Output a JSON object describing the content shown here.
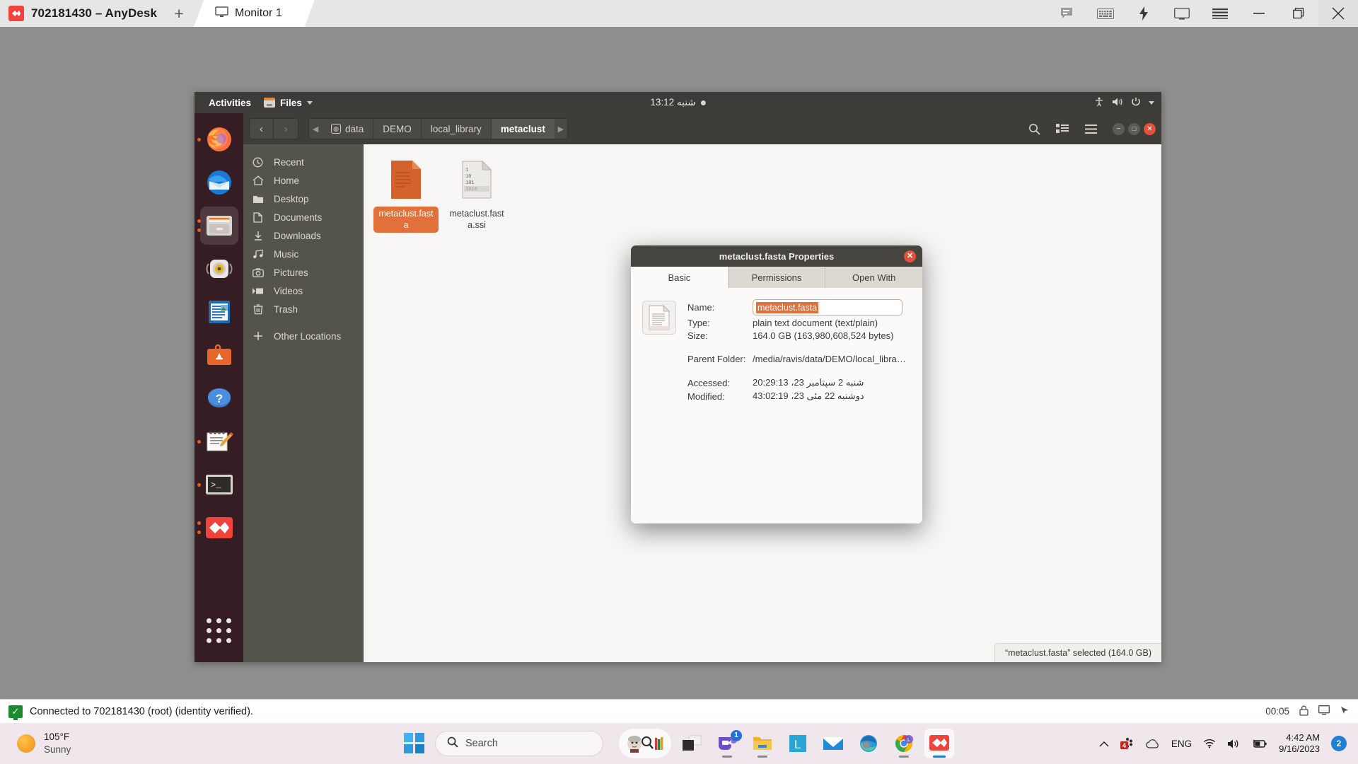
{
  "anydesk": {
    "brand_title": "702181430 – AnyDesk",
    "new_tab_label": "+",
    "tab_label": "Monitor 1",
    "tab_icon": "monitor-icon",
    "toolbar_icons": [
      "chat-icon",
      "keyboard-icon",
      "lightning-icon",
      "screen-icon",
      "hamburger-menu-icon"
    ],
    "window_controls": {
      "minimize": "—",
      "maximize": "❐",
      "close": "✕"
    },
    "status_text": "Connected to 702181430 (root) (identity verified).",
    "status_icon": "connected-check-icon",
    "session_time": "00:05",
    "status_right_icons": [
      "lock-icon",
      "monitor-icon",
      "arrow-icon"
    ]
  },
  "gnome": {
    "activities": "Activities",
    "app_menu": "Files",
    "app_menu_icon": "files-app-icon",
    "clock": "شنبه 13:12",
    "tray_icons": [
      "accessibility-icon",
      "volume-icon",
      "power-icon",
      "chevron-down-icon"
    ]
  },
  "dock": {
    "items": [
      {
        "name": "firefox-icon",
        "label": "Firefox",
        "running": true,
        "active": false
      },
      {
        "name": "thunderbird-icon",
        "label": "Thunderbird",
        "running": false,
        "active": false
      },
      {
        "name": "files-icon",
        "label": "Files",
        "running": true,
        "active": true
      },
      {
        "name": "rhythmbox-icon",
        "label": "Rhythmbox",
        "running": false,
        "active": false
      },
      {
        "name": "libreoffice-writer-icon",
        "label": "LibreOffice Writer",
        "running": false,
        "active": false
      },
      {
        "name": "ubuntu-software-icon",
        "label": "Ubuntu Software",
        "running": false,
        "active": false
      },
      {
        "name": "help-icon",
        "label": "Help",
        "running": false,
        "active": false
      },
      {
        "name": "text-editor-icon",
        "label": "Text Editor",
        "running": true,
        "active": false
      },
      {
        "name": "terminal-icon",
        "label": "Terminal",
        "running": true,
        "active": false
      },
      {
        "name": "anydesk-icon",
        "label": "AnyDesk",
        "running": true,
        "active": false
      }
    ],
    "show_apps_label": "Show Applications"
  },
  "nautilus": {
    "nav": {
      "back": "‹",
      "forward": "›"
    },
    "breadcrumbs": [
      {
        "label": "data",
        "icon": "device-icon",
        "current": false
      },
      {
        "label": "DEMO",
        "icon": "",
        "current": false
      },
      {
        "label": "local_library",
        "icon": "",
        "current": false
      },
      {
        "label": "metaclust",
        "icon": "",
        "current": true
      }
    ],
    "header_buttons": [
      "search-icon",
      "view-toggle-icon",
      "hamburger-menu-icon"
    ],
    "window_controls": [
      "minimize",
      "maximize",
      "close"
    ],
    "sidebar": [
      {
        "label": "Recent",
        "icon": "clock-icon"
      },
      {
        "label": "Home",
        "icon": "home-icon"
      },
      {
        "label": "Desktop",
        "icon": "folder-icon"
      },
      {
        "label": "Documents",
        "icon": "document-icon"
      },
      {
        "label": "Downloads",
        "icon": "download-icon"
      },
      {
        "label": "Music",
        "icon": "music-icon"
      },
      {
        "label": "Pictures",
        "icon": "camera-icon"
      },
      {
        "label": "Videos",
        "icon": "video-icon"
      },
      {
        "label": "Trash",
        "icon": "trash-icon"
      },
      {
        "label": "Other Locations",
        "icon": "plus-icon"
      }
    ],
    "files": [
      {
        "label": "metaclust.fasta",
        "icon": "text-file-icon",
        "selected": true
      },
      {
        "label": "metaclust.fasta.ssi",
        "icon": "binary-file-icon",
        "selected": false
      }
    ],
    "status_bar": "“metaclust.fasta” selected  (164.0 GB)"
  },
  "properties_dialog": {
    "title": "metaclust.fasta Properties",
    "close_label": "✕",
    "tabs": [
      {
        "label": "Basic",
        "active": true
      },
      {
        "label": "Permissions",
        "active": false
      },
      {
        "label": "Open With",
        "active": false
      }
    ],
    "thumb_icon": "text-document-icon",
    "fields": {
      "name_label": "Name:",
      "name_value": "metaclust.fasta",
      "type_label": "Type:",
      "type_value": "plain text document (text/plain)",
      "size_label": "Size:",
      "size_value": "164.0 GB (163,980,608,524 bytes)",
      "parent_label": "Parent Folder:",
      "parent_value": "/media/ravis/data/DEMO/local_libra…",
      "accessed_label": "Accessed:",
      "accessed_value": "شنبه  2 سپتامبر 23، 20:29:13",
      "modified_label": "Modified:",
      "modified_value": "دوشنبه 22 مئی 23، 43:02:19"
    }
  },
  "windows_taskbar": {
    "weather": {
      "temp": "105°F",
      "condition": "Sunny",
      "icon": "sun-icon"
    },
    "start_label": "Start",
    "search": {
      "placeholder": "Search",
      "icon": "search-icon"
    },
    "apps": [
      {
        "name": "copilot-pill-icon",
        "label": "Search Highlights",
        "badge": "",
        "running": false
      },
      {
        "name": "task-view-icon",
        "label": "Task View",
        "badge": "",
        "running": false
      },
      {
        "name": "teams-icon",
        "label": "Microsoft Teams",
        "badge": "1",
        "running": true
      },
      {
        "name": "file-explorer-icon",
        "label": "File Explorer",
        "badge": "",
        "running": true
      },
      {
        "name": "onenote-icon",
        "label": "OneNote",
        "badge": "",
        "running": false
      },
      {
        "name": "mail-icon",
        "label": "Mail",
        "badge": "",
        "running": false
      },
      {
        "name": "edge-icon",
        "label": "Microsoft Edge",
        "badge": "",
        "running": false
      },
      {
        "name": "chrome-icon",
        "label": "Google Chrome",
        "badge": "",
        "running": true
      },
      {
        "name": "anydesk-icon",
        "label": "AnyDesk",
        "badge": "",
        "running": true
      }
    ],
    "tray": {
      "overflow_icon": "chevron-up-icon",
      "app_icons": [
        "tray-app-icon",
        "cloud-icon"
      ],
      "language": "ENG",
      "system_icons": [
        "wifi-icon",
        "volume-icon",
        "battery-icon"
      ],
      "time": "4:42 AM",
      "date": "9/16/2023",
      "notification_count": "2"
    }
  },
  "colors": {
    "anydesk_red": "#ef443b",
    "ubuntu_orange": "#e2703a",
    "gnome_dark": "#3c3b37",
    "selection": "#e2703a",
    "taskbar_bg": "#efe7ec",
    "status_green": "#1a8b2e"
  }
}
